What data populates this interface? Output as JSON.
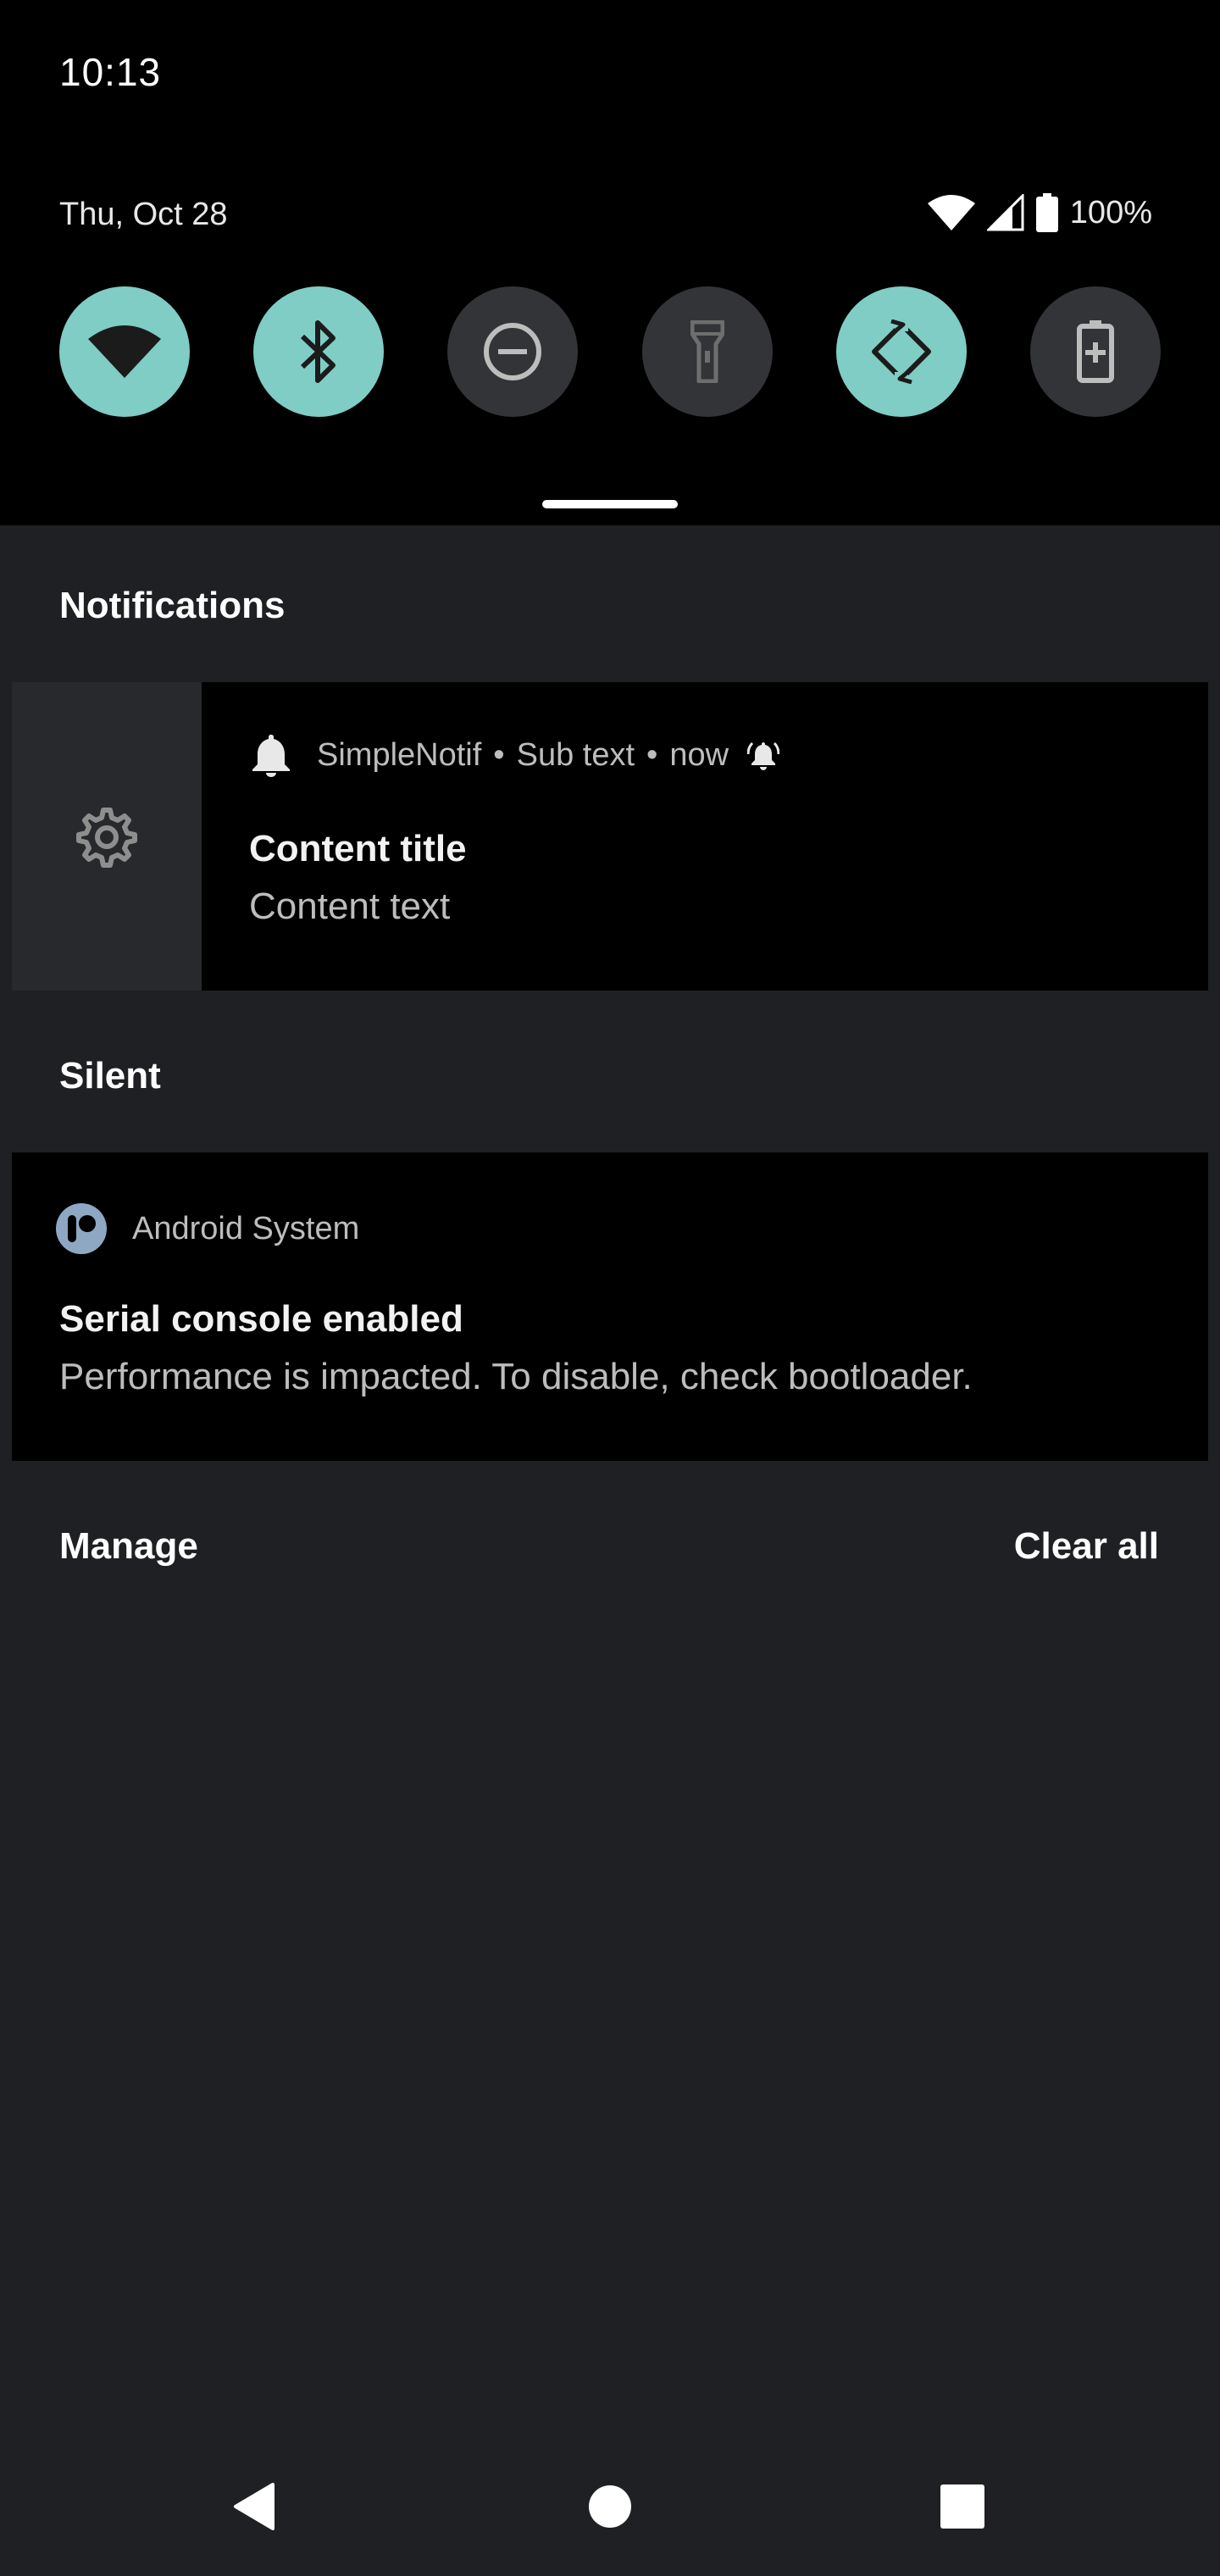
{
  "status_bar": {
    "time": "10:13"
  },
  "quick_settings": {
    "date": "Thu, Oct 28",
    "battery_percent": "100%",
    "accent_color": "#7fcdc5",
    "tiles": [
      {
        "name": "wifi",
        "icon": "wifi-icon",
        "state": "on"
      },
      {
        "name": "bluetooth",
        "icon": "bluetooth-icon",
        "state": "on"
      },
      {
        "name": "do-not-disturb",
        "icon": "dnd-icon",
        "state": "off"
      },
      {
        "name": "flashlight",
        "icon": "flashlight-icon",
        "state": "off"
      },
      {
        "name": "auto-rotate",
        "icon": "auto-rotate-icon",
        "state": "on"
      },
      {
        "name": "battery-saver",
        "icon": "battery-saver-icon",
        "state": "off"
      }
    ]
  },
  "notifications_section": {
    "header": "Notifications",
    "card": {
      "app_name": "SimpleNotif",
      "separator": "•",
      "sub_text": "Sub text",
      "time": "now",
      "title": "Content title",
      "text": "Content text"
    }
  },
  "silent_section": {
    "header": "Silent",
    "card": {
      "app_name": "Android System",
      "title": "Serial console enabled",
      "text": "Performance is impacted. To disable, check bootloader."
    }
  },
  "footer": {
    "manage_label": "Manage",
    "clear_all_label": "Clear all"
  }
}
